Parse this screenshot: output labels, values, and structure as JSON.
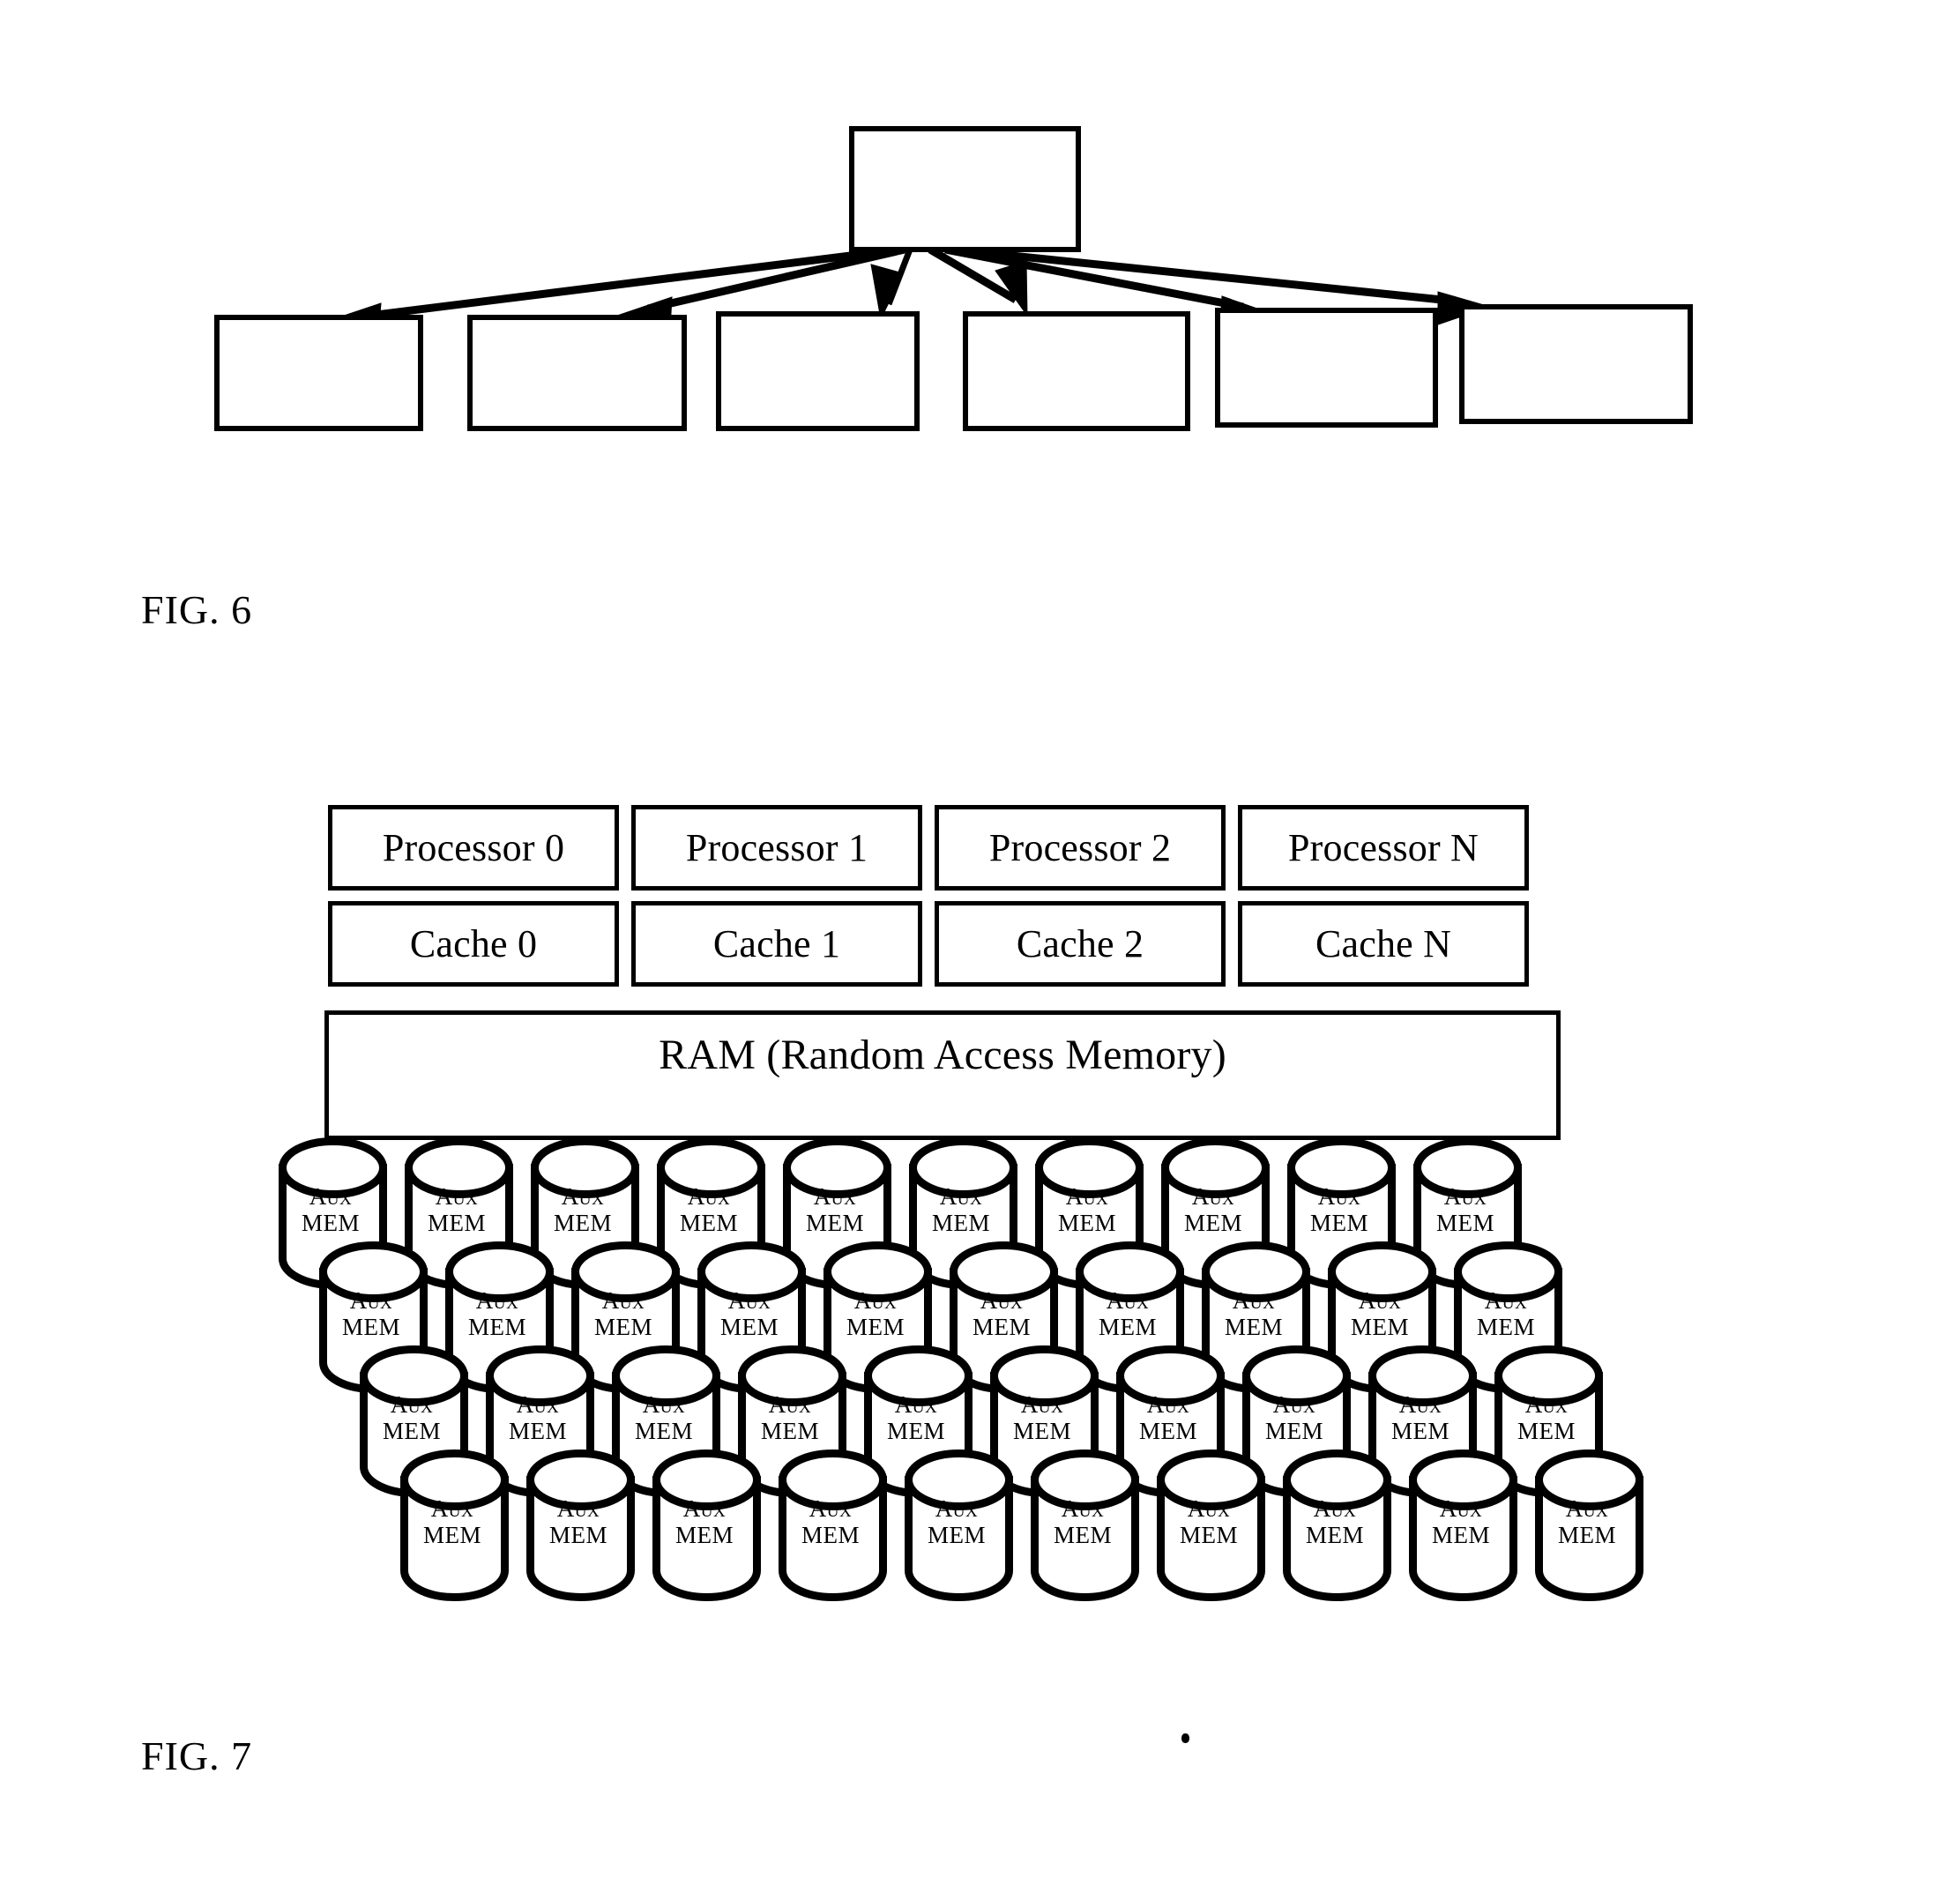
{
  "document": {
    "type": "patent-drawing-sheet",
    "background_color": "#ffffff",
    "ink_color": "#000000"
  },
  "figures": [
    {
      "id": "fig6",
      "caption": "FIG. 6",
      "description": "A single unlabeled parent block at the top with six arrows fanning outward and downward to six unlabeled child blocks arranged in a row.",
      "parent_block": {
        "label": ""
      },
      "child_blocks": [
        {
          "label": ""
        },
        {
          "label": ""
        },
        {
          "label": ""
        },
        {
          "label": ""
        },
        {
          "label": ""
        },
        {
          "label": ""
        }
      ],
      "arrow_count": 6
    },
    {
      "id": "fig7",
      "caption": "FIG. 7",
      "description": "Four processors each over a cache, above a shared RAM block, above a bank of forty auxiliary memory cylinders in four staggered rows of ten.",
      "processors": [
        {
          "label": "Processor 0"
        },
        {
          "label": "Processor 1"
        },
        {
          "label": "Processor 2"
        },
        {
          "label": "Processor N"
        }
      ],
      "caches": [
        {
          "label": "Cache 0"
        },
        {
          "label": "Cache 1"
        },
        {
          "label": "Cache 2"
        },
        {
          "label": "Cache N"
        }
      ],
      "ram": {
        "label": "RAM (Random Access Memory)"
      },
      "aux_memory": {
        "cell_label_line1": "Aux",
        "cell_label_line2": "MEM",
        "rows": 4,
        "columns": 10,
        "total": 40
      }
    }
  ]
}
